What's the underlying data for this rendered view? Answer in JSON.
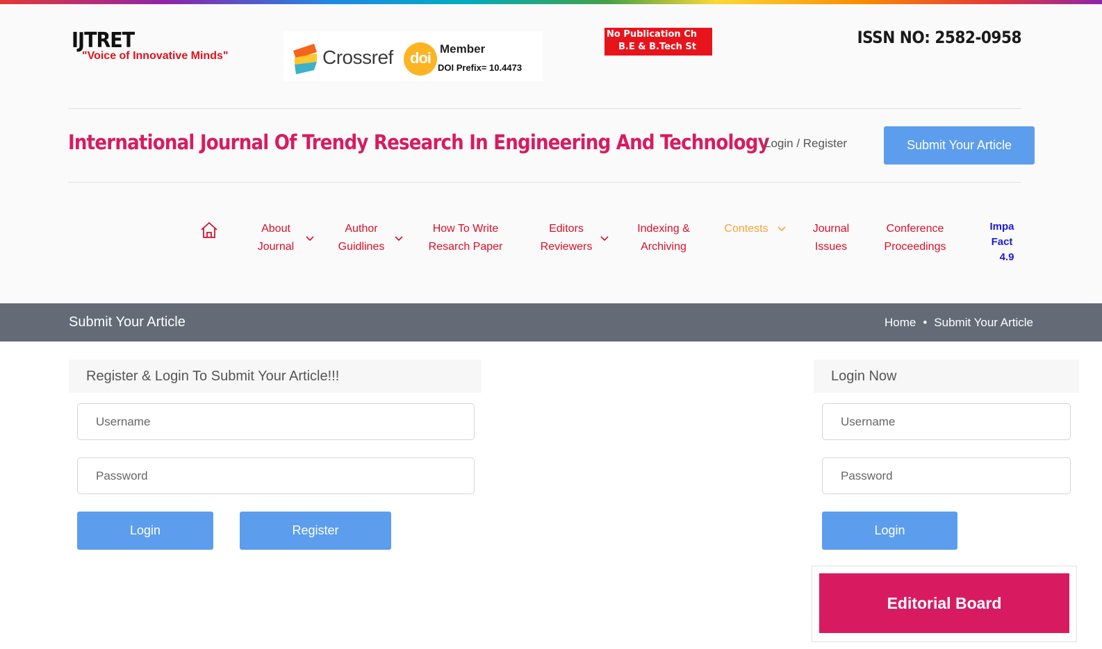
{
  "logo": {
    "name": "IJTRET",
    "tagline": "\"Voice of Innovative Minds\""
  },
  "crossref": {
    "brand": "Crossref",
    "doi_mark": "doi",
    "member": "Member",
    "prefix": "DOI Prefix= 10.4473"
  },
  "notice": {
    "line1": "No Publication Ch",
    "line2": "B.E & B.Tech St"
  },
  "issn": "ISSN NO: 2582-0958",
  "site_title": "International Journal Of Trendy Research In Engineering And Technology",
  "header": {
    "login_register": "Login / Register",
    "submit_button": "Submit Your Article"
  },
  "nav": {
    "home_icon": "home-icon",
    "items": [
      {
        "line1": "About",
        "line2": "Journal"
      },
      {
        "line1": "Author",
        "line2": "Guidlines"
      },
      {
        "line1": "How To Write",
        "line2": "Resarch Paper"
      },
      {
        "line1": "Editors",
        "line2": "Reviewers"
      },
      {
        "line1": "Indexing &",
        "line2": "Archiving"
      },
      {
        "line1": "Contests",
        "line2": ""
      },
      {
        "line1": "Journal",
        "line2": "Issues"
      },
      {
        "line1": "Conference",
        "line2": "Proceedings"
      },
      {
        "line1": "Impa",
        "line2": "Fact",
        "line3": "4.9"
      }
    ],
    "colors": {
      "default": "#d90f2a",
      "contests": "#f7a23b",
      "impact": "#1b1bd6"
    }
  },
  "banner": {
    "title": "Submit Your Article",
    "breadcrumb_home": "Home",
    "breadcrumb_sep": "•",
    "breadcrumb_current": "Submit Your Article"
  },
  "left_panel": {
    "heading": "Register & Login To Submit Your Article!!!",
    "username_placeholder": "Username",
    "password_placeholder": "Password",
    "login_button": "Login",
    "register_button": "Register"
  },
  "right_panel": {
    "heading": "Login Now",
    "username_placeholder": "Username",
    "password_placeholder": "Password",
    "login_button": "Login",
    "editorial_button": "Editorial Board"
  },
  "colors": {
    "accent": "#5c9ded",
    "brand": "#d81b60",
    "banner": "#646b77"
  }
}
